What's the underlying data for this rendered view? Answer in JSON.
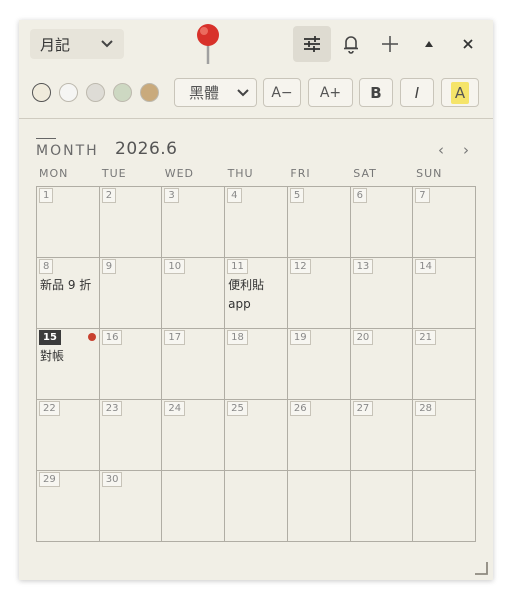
{
  "titlebar": {
    "view_select": "月記",
    "buttons": [
      "settings",
      "reminder",
      "new-note",
      "collapse",
      "close"
    ]
  },
  "format": {
    "swatches": [
      {
        "name": "cream",
        "color": "#f0ebdc",
        "selected": true
      },
      {
        "name": "white",
        "color": "#f5f5f3",
        "selected": false
      },
      {
        "name": "gray",
        "color": "#dedcd6",
        "selected": false
      },
      {
        "name": "sage",
        "color": "#cdd8c2",
        "selected": false
      },
      {
        "name": "tan",
        "color": "#c9aa7c",
        "selected": false
      }
    ],
    "font": "黑體",
    "font_decrease": "A−",
    "font_increase": "A+",
    "bold": "B",
    "italic": "I",
    "highlight": "A",
    "highlight_color": "#f5e46a"
  },
  "calendar": {
    "label": "MONTH",
    "month": "2026.6",
    "prev": "‹",
    "next": "›",
    "weekdays": [
      "MON",
      "TUE",
      "WED",
      "THU",
      "FRI",
      "SAT",
      "SUN"
    ],
    "today_color": "#3b3b3b",
    "dot_color": "#c8412f",
    "weeks": [
      [
        {
          "day": "1"
        },
        {
          "day": "2"
        },
        {
          "day": "3"
        },
        {
          "day": "4"
        },
        {
          "day": "5"
        },
        {
          "day": "6"
        },
        {
          "day": "7"
        }
      ],
      [
        {
          "day": "8",
          "note": "新品 9 折"
        },
        {
          "day": "9"
        },
        {
          "day": "10"
        },
        {
          "day": "11",
          "note": "便利貼\napp"
        },
        {
          "day": "12"
        },
        {
          "day": "13"
        },
        {
          "day": "14"
        }
      ],
      [
        {
          "day": "15",
          "today": true,
          "dot": true,
          "note": "對帳"
        },
        {
          "day": "16"
        },
        {
          "day": "17"
        },
        {
          "day": "18"
        },
        {
          "day": "19"
        },
        {
          "day": "20"
        },
        {
          "day": "21"
        }
      ],
      [
        {
          "day": "22"
        },
        {
          "day": "23"
        },
        {
          "day": "24"
        },
        {
          "day": "25"
        },
        {
          "day": "26"
        },
        {
          "day": "27"
        },
        {
          "day": "28"
        }
      ],
      [
        {
          "day": "29"
        },
        {
          "day": "30"
        },
        {
          "day": ""
        },
        {
          "day": ""
        },
        {
          "day": ""
        },
        {
          "day": ""
        },
        {
          "day": ""
        }
      ]
    ]
  }
}
